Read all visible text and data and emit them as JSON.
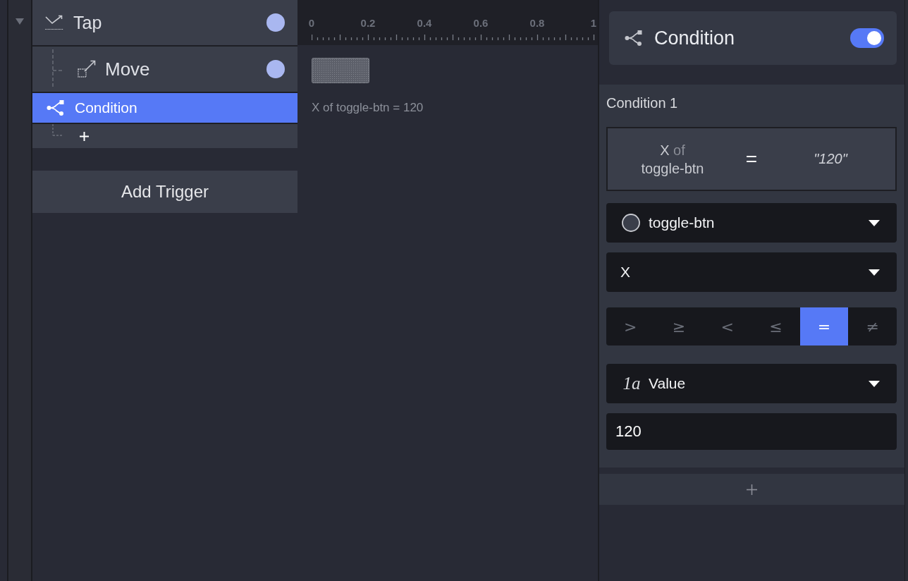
{
  "outline": {
    "expanded": true
  },
  "tree": {
    "items": [
      {
        "kind": "trigger",
        "label": "Tap",
        "selected": false,
        "children": [
          {
            "kind": "action",
            "label": "Move",
            "selected": false
          },
          {
            "kind": "condition",
            "label": "Condition",
            "selected": true
          },
          {
            "kind": "add",
            "selected": false
          }
        ]
      }
    ],
    "add_button": "Add Trigger"
  },
  "timeline": {
    "ruler_labels": [
      "0",
      "0.2",
      "0.4",
      "0.6",
      "0.8",
      "1"
    ],
    "caption": "X of toggle-btn = 120"
  },
  "inspector": {
    "title": "Condition",
    "enabled": true,
    "conditions": [
      {
        "heading": "Condition 1",
        "summary": {
          "property": "X",
          "connector": "of",
          "target": "toggle-btn",
          "operator": "=",
          "value": "\"120\""
        },
        "target_select": {
          "value": "toggle-btn"
        },
        "property_select": {
          "value": "X"
        },
        "operators": [
          {
            "label": ">",
            "selected": false
          },
          {
            "label": "≥",
            "selected": false
          },
          {
            "label": "<",
            "selected": false
          },
          {
            "label": "≤",
            "selected": false
          },
          {
            "label": "=",
            "selected": true
          },
          {
            "label": "≠",
            "selected": false
          }
        ],
        "value_type_select": {
          "type_icon": "1a",
          "value": "Value"
        },
        "value_input": {
          "value": "120"
        }
      }
    ]
  }
}
